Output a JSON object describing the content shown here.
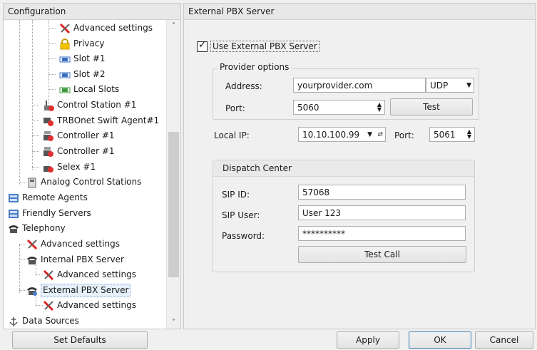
{
  "left_panel": {
    "header": "Configuration",
    "tree": [
      {
        "label": "Advanced settings",
        "icon": "tools-icon"
      },
      {
        "label": "Privacy",
        "icon": "lock-icon"
      },
      {
        "label": "Slot #1",
        "icon": "slot-icon"
      },
      {
        "label": "Slot #2",
        "icon": "slot-icon"
      },
      {
        "label": "Local Slots",
        "icon": "local-slots-icon"
      },
      {
        "label": "Control Station #1",
        "icon": "control-station-icon"
      },
      {
        "label": "TRBOnet Swift Agent#1",
        "icon": "swift-agent-icon"
      },
      {
        "label": "Controller #1",
        "icon": "controller-icon"
      },
      {
        "label": "Controller #1",
        "icon": "controller-icon"
      },
      {
        "label": "Selex #1",
        "icon": "selex-icon"
      },
      {
        "label": "Analog Control Stations",
        "icon": "analog-stations-icon"
      },
      {
        "label": "Remote Agents",
        "icon": "remote-agents-icon"
      },
      {
        "label": "Friendly Servers",
        "icon": "servers-icon"
      },
      {
        "label": "Telephony",
        "icon": "telephone-icon"
      },
      {
        "label": "Advanced settings",
        "icon": "tools-icon"
      },
      {
        "label": "Internal PBX Server",
        "icon": "telephone-icon"
      },
      {
        "label": "Advanced settings",
        "icon": "tools-icon"
      },
      {
        "label": "External PBX Server",
        "icon": "external-pbx-icon"
      },
      {
        "label": "Advanced settings",
        "icon": "tools-icon"
      },
      {
        "label": "Data Sources",
        "icon": "data-sources-icon"
      }
    ]
  },
  "right_panel": {
    "header": "External PBX Server",
    "use_external": {
      "label": "Use External PBX Server",
      "checked": true
    },
    "provider": {
      "title": "Provider options",
      "address_label": "Address:",
      "address_value": "yourprovider.com",
      "protocol": "UDP",
      "port_label": "Port:",
      "port_value": "5060",
      "test_label": "Test"
    },
    "local": {
      "ip_label": "Local IP:",
      "ip_value": "10.10.100.99",
      "port_label": "Port:",
      "port_value": "5061"
    },
    "dispatch": {
      "title": "Dispatch Center",
      "sip_id_label": "SIP ID:",
      "sip_id_value": "57068",
      "sip_user_label": "SIP User:",
      "sip_user_value": "User 123",
      "password_label": "Password:",
      "password_value": "**********",
      "test_call_label": "Test Call"
    }
  },
  "footer": {
    "set_defaults": "Set Defaults",
    "apply": "Apply",
    "ok": "OK",
    "cancel": "Cancel"
  }
}
